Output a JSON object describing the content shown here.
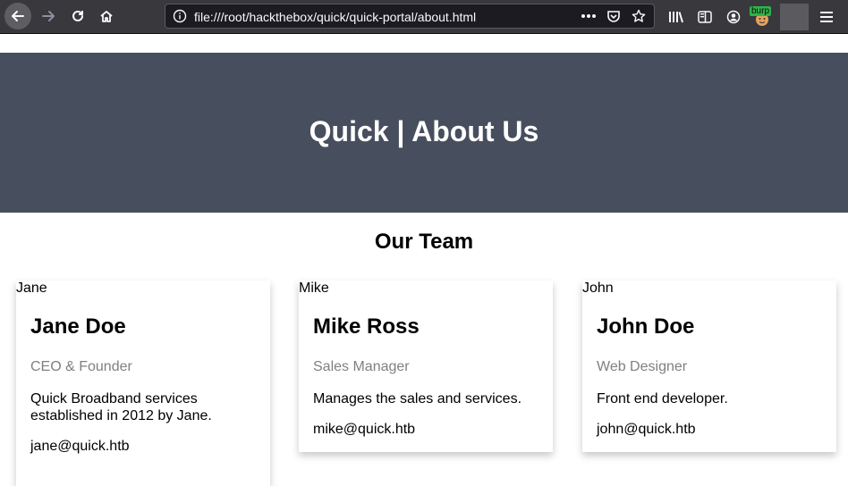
{
  "browser": {
    "url": "file:///root/hackthebox/quick/quick-portal/about.html",
    "burp_label": "burp"
  },
  "page": {
    "hero_title": "Quick | About Us",
    "team_title": "Our Team"
  },
  "team": [
    {
      "img_alt": "Jane",
      "name": "Jane Doe",
      "role": "CEO & Founder",
      "desc": "Quick Broadband services established in 2012 by Jane.",
      "email": "jane@quick.htb"
    },
    {
      "img_alt": "Mike",
      "name": "Mike Ross",
      "role": "Sales Manager",
      "desc": "Manages the sales and services.",
      "email": "mike@quick.htb"
    },
    {
      "img_alt": "John",
      "name": "John Doe",
      "role": "Web Designer",
      "desc": "Front end developer.",
      "email": "john@quick.htb"
    }
  ],
  "colors": {
    "hero_bg": "#474e5d",
    "toolbar_bg": "#38383d",
    "role_text": "#808080"
  }
}
